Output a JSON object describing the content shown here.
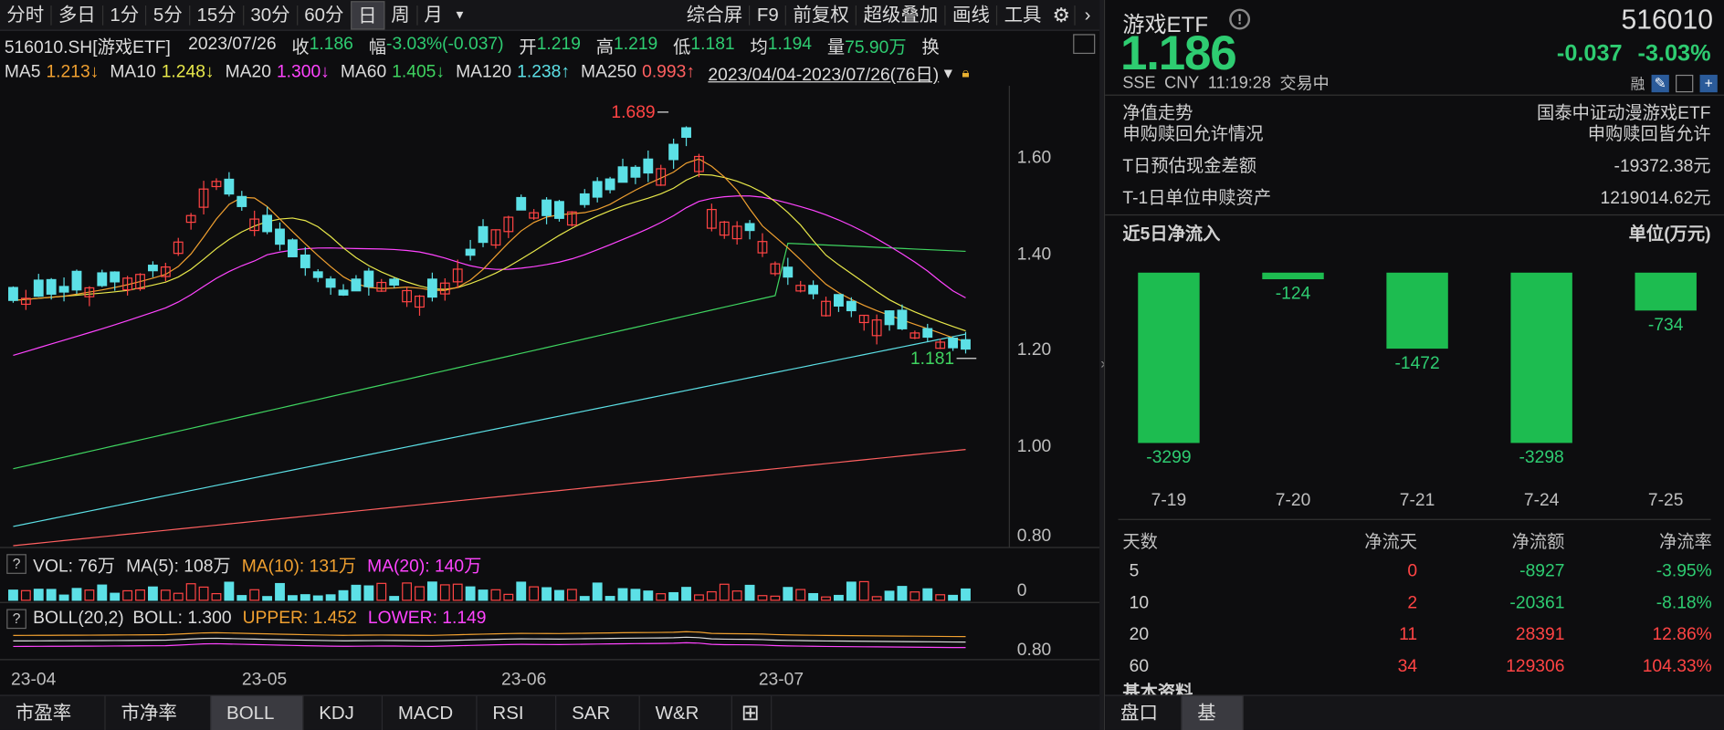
{
  "toolbar": {
    "periods": [
      "分时",
      "多日",
      "1分",
      "5分",
      "15分",
      "30分",
      "60分",
      "日",
      "周",
      "月"
    ],
    "active_period": "日",
    "right_tools": [
      "综合屏",
      "F9",
      "前复权",
      "超级叠加",
      "画线",
      "工具"
    ]
  },
  "quote_line": {
    "code": "516010.SH[游戏ETF]",
    "date": "2023/07/26",
    "close_label": "收",
    "close": "1.186",
    "chg_label": "幅",
    "chg": "-3.03%(-0.037)",
    "open_label": "开",
    "open": "1.219",
    "high_label": "高",
    "high": "1.219",
    "low_label": "低",
    "low": "1.181",
    "avg_label": "均",
    "avg": "1.194",
    "vol_label": "量",
    "vol": "75.90万",
    "turnover_label": "换"
  },
  "ma_line": {
    "items": [
      {
        "label": "MA5",
        "value": "1.213↓",
        "color": "#f0a030"
      },
      {
        "label": "MA10",
        "value": "1.248↓",
        "color": "#e8e84a"
      },
      {
        "label": "MA20",
        "value": "1.300↓",
        "color": "#ff44ff"
      },
      {
        "label": "MA60",
        "value": "1.405↓",
        "color": "#3fd460"
      },
      {
        "label": "MA120",
        "value": "1.238↑",
        "color": "#5ce0e6"
      },
      {
        "label": "MA250",
        "value": "0.993↑",
        "color": "#ff6060"
      }
    ],
    "range": "2023/04/04-2023/07/26(76日)"
  },
  "main_chart": {
    "y_ticks": [
      "1.60",
      "1.40",
      "1.20",
      "1.00",
      "0.80"
    ],
    "max_label": "1.689",
    "min_label": "1.181",
    "x_ticks": [
      "23-04",
      "23-05",
      "23-06",
      "23-07"
    ]
  },
  "vol_panel": {
    "name": "VOL: 76万",
    "ma5": "MA(5): 108万",
    "ma10": "MA(10): 131万",
    "ma20": "MA(20): 140万",
    "y_tick": "0"
  },
  "boll_panel": {
    "name": "BOLL(20,2)",
    "boll": "BOLL: 1.300",
    "upper": "UPPER: 1.452",
    "lower": "LOWER: 1.149",
    "y_tick": "0.80"
  },
  "bottom_tabs": [
    "市盈率",
    "市净率",
    "BOLL",
    "KDJ",
    "MACD",
    "RSI",
    "SAR",
    "W&R"
  ],
  "bottom_active": "BOLL",
  "right": {
    "name": "游戏ETF",
    "code": "516010",
    "price": "1.186",
    "chg": "-0.037",
    "pct": "-3.03%",
    "market": "SSE",
    "currency": "CNY",
    "time": "11:19:28",
    "status": "交易中",
    "rong": "融",
    "nav_label": "净值走势",
    "fund_name": "国泰中证动漫游戏ETF",
    "rows": [
      {
        "k": "申购赎回允许情况",
        "v": "申购赎回皆允许"
      },
      {
        "k": "T日预估现金差额",
        "v": "-19372.38元"
      },
      {
        "k": "T-1日单位申赎资产",
        "v": "1219014.62元"
      }
    ],
    "flow_title": "近5日净流入",
    "flow_unit": "单位(万元)",
    "flow_dates": [
      "7-19",
      "7-20",
      "7-21",
      "7-24",
      "7-25"
    ],
    "flow_values": [
      "-3299",
      "-124",
      "-1472",
      "-3298",
      "-734"
    ],
    "table_head": [
      "天数",
      "净流天",
      "净流额",
      "净流率"
    ],
    "table": [
      [
        "5",
        "0",
        "-8927",
        "-3.95%"
      ],
      [
        "10",
        "2",
        "-20361",
        "-8.18%"
      ],
      [
        "20",
        "11",
        "28391",
        "12.86%"
      ],
      [
        "60",
        "34",
        "129306",
        "104.33%"
      ]
    ],
    "basic_label": "基本资料",
    "tabs": [
      "盘口",
      "基本"
    ]
  }
}
